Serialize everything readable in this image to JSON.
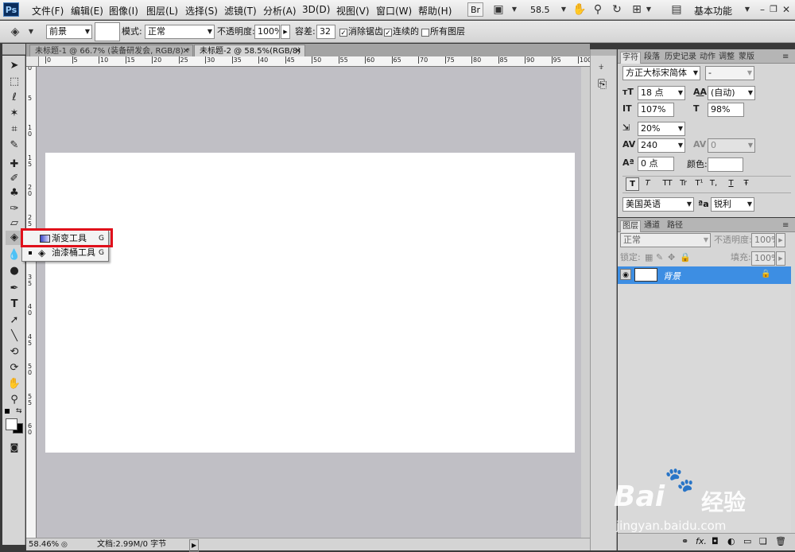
{
  "menubar": {
    "logo": "Ps",
    "items": [
      "文件(F)",
      "编辑(E)",
      "图像(I)",
      "图层(L)",
      "选择(S)",
      "滤镜(T)",
      "分析(A)",
      "3D(D)",
      "视图(V)",
      "窗口(W)",
      "帮助(H)"
    ],
    "bridge_label": "Br",
    "zoom": "58.5",
    "workspace": "基本功能"
  },
  "options": {
    "fill_source": "前景",
    "mode_label": "模式:",
    "mode_value": "正常",
    "opacity_label": "不透明度:",
    "opacity_value": "100%",
    "tolerance_label": "容差:",
    "tolerance_value": "32",
    "antialias_label": "消除锯齿",
    "contiguous_label": "连续的",
    "all_layers_label": "所有图层"
  },
  "tabs": [
    {
      "label": "未标题-1 @ 66.7% (装备研发会, RGB/8) *"
    },
    {
      "label": "未标题-2 @ 58.5%(RGB/8)"
    }
  ],
  "ruler_top": [
    "0",
    "5",
    "10",
    "15",
    "20",
    "25",
    "30",
    "35",
    "40",
    "45",
    "50",
    "55",
    "60",
    "65",
    "70",
    "75",
    "80",
    "85",
    "90",
    "95",
    "100"
  ],
  "ruler_left": [
    "0",
    "5",
    "1\n0",
    "1\n5",
    "2\n0",
    "2\n5",
    "3\n0",
    "3\n5",
    "4\n0",
    "4\n5",
    "5\n0",
    "5\n5",
    "6\n0"
  ],
  "flyout": {
    "items": [
      {
        "label": "渐变工具",
        "key": "G"
      },
      {
        "label": "油漆桶工具",
        "key": "G"
      }
    ]
  },
  "status": {
    "zoom": "58.46%",
    "doc": "文档:2.99M/0 字节"
  },
  "character": {
    "tabs": [
      "字符",
      "段落",
      "历史记录",
      "动作",
      "调整",
      "蒙版"
    ],
    "font_family": "方正大标宋简体",
    "font_style": "-",
    "font_size": "18 点",
    "leading": "(自动)",
    "vscale": "107%",
    "hscale": "98%",
    "tsume": "20%",
    "kerning": "240",
    "tracking": "0",
    "baseline": "0 点",
    "color_label": "颜色:",
    "language": "美国英语",
    "aa_symbol": "ªa",
    "antialias": "锐利",
    "format_buttons": [
      "T",
      "T",
      "TT",
      "Tr",
      "T¹",
      "T,",
      "T",
      "Ŧ"
    ]
  },
  "layers": {
    "tabs": [
      "图层",
      "通道",
      "路径"
    ],
    "blend": "正常",
    "opacity_label": "不透明度:",
    "opacity_value": "100%",
    "lock_label": "锁定:",
    "fill_label": "填充:",
    "fill_value": "100%",
    "layer_name": "背景",
    "bottom_icons": [
      "link-icon",
      "fx-icon",
      "mask-icon",
      "adjustment-icon",
      "group-icon",
      "new-layer-icon",
      "trash-icon"
    ],
    "fx_label": "fx."
  },
  "watermark": {
    "brand": "Bai",
    "brand2": "经验",
    "url": "jingyan.baidu.com"
  },
  "colors": {
    "accent": "#e0101b",
    "selection": "#3d8ee3",
    "canvas_bg": "#c0bfc5"
  }
}
